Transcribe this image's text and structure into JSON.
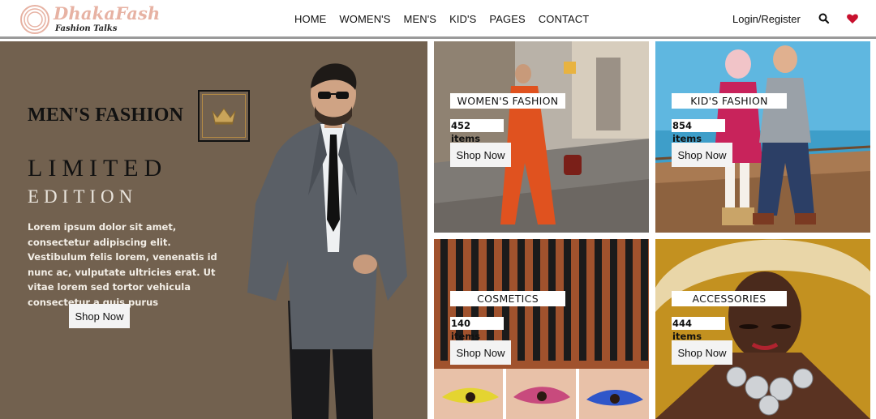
{
  "brand": {
    "name": "DhakaFash",
    "tagline": "Fashion Talks"
  },
  "nav": {
    "items": [
      {
        "label": "HOME"
      },
      {
        "label": "WOMEN'S"
      },
      {
        "label": "MEN'S"
      },
      {
        "label": "KID'S"
      },
      {
        "label": "PAGES"
      },
      {
        "label": "CONTACT"
      }
    ],
    "login_label": "Login/Register",
    "search_icon": "search-icon",
    "wishlist_icon": "heart-icon"
  },
  "colors": {
    "hero_bg": "#72614f",
    "accent_heart": "#c8102e",
    "logo_pink": "#e7b2a3",
    "crown_gold": "#b48a45"
  },
  "hero": {
    "title": "MEN'S FASHION",
    "line1": "LIMITED",
    "line2": "EDITION",
    "description": "Lorem ipsum dolor sit amet, consectetur adipiscing elit. Vestibulum felis lorem, venenatis id nunc ac, vulputate ultricies erat. Ut vitae lorem sed tortor vehicula consectetur a quis purus",
    "button": "Shop Now",
    "icon": "crown-icon"
  },
  "categories": [
    {
      "label": "WOMEN'S FASHION",
      "count": "452 items",
      "button": "Shop Now"
    },
    {
      "label": "KID'S FASHION",
      "count": "854 items",
      "button": "Shop Now"
    },
    {
      "label": "COSMETICS",
      "count": "140 items",
      "button": "Shop Now"
    },
    {
      "label": "ACCESSORIES",
      "count": "444 items",
      "button": "Shop Now"
    }
  ]
}
